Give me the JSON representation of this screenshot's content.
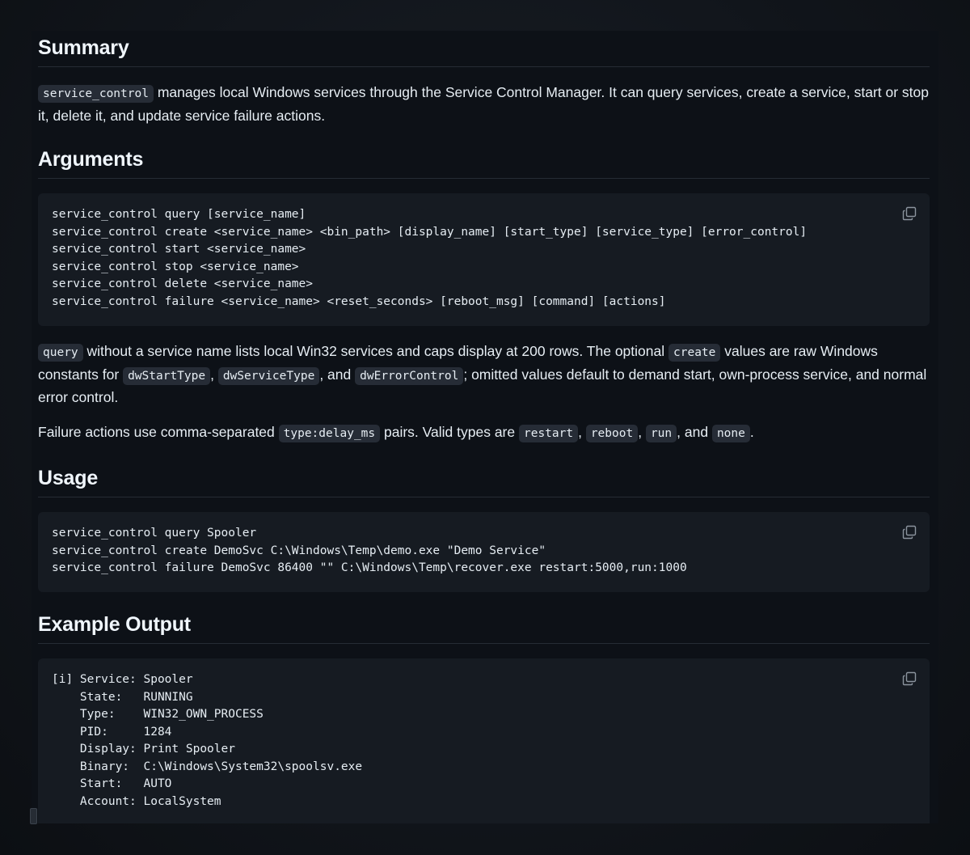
{
  "summary": {
    "heading": "Summary",
    "code_name": "service_control",
    "text": " manages local Windows services through the Service Control Manager. It can query services, create a service, start or stop it, delete it, and update service failure actions."
  },
  "arguments": {
    "heading": "Arguments",
    "code": "service_control query [service_name]\nservice_control create <service_name> <bin_path> [display_name] [start_type] [service_type] [error_control]\nservice_control start <service_name>\nservice_control stop <service_name>\nservice_control delete <service_name>\nservice_control failure <service_name> <reset_seconds> [reboot_msg] [command] [actions]",
    "para1": {
      "c1": "query",
      "t1": " without a service name lists local Win32 services and caps display at 200 rows. The optional ",
      "c2": "create",
      "t2": " values are raw Windows constants for ",
      "c3": "dwStartType",
      "t3": ", ",
      "c4": "dwServiceType",
      "t4": ", and ",
      "c5": "dwErrorControl",
      "t5": "; omitted values default to demand start, own-process service, and normal error control."
    },
    "para2": {
      "t1": "Failure actions use comma-separated ",
      "c1": "type:delay_ms",
      "t2": " pairs. Valid types are ",
      "c2": "restart",
      "t3": ", ",
      "c3": "reboot",
      "t4": ", ",
      "c4": "run",
      "t5": ", and ",
      "c5": "none",
      "t6": "."
    }
  },
  "usage": {
    "heading": "Usage",
    "code": "service_control query Spooler\nservice_control create DemoSvc C:\\Windows\\Temp\\demo.exe \"Demo Service\"\nservice_control failure DemoSvc 86400 \"\" C:\\Windows\\Temp\\recover.exe restart:5000,run:1000"
  },
  "example": {
    "heading": "Example Output",
    "code": "[i] Service: Spooler\n    State:   RUNNING\n    Type:    WIN32_OWN_PROCESS\n    PID:     1284\n    Display: Print Spooler\n    Binary:  C:\\Windows\\System32\\spoolsv.exe\n    Start:   AUTO\n    Account: LocalSystem"
  },
  "icons": {
    "copy": "copy-icon"
  },
  "colors": {
    "panel_bg": "#0d1117",
    "code_bg": "#161b22",
    "inline_code_bg": "#262c36",
    "text": "#e6edf3"
  }
}
